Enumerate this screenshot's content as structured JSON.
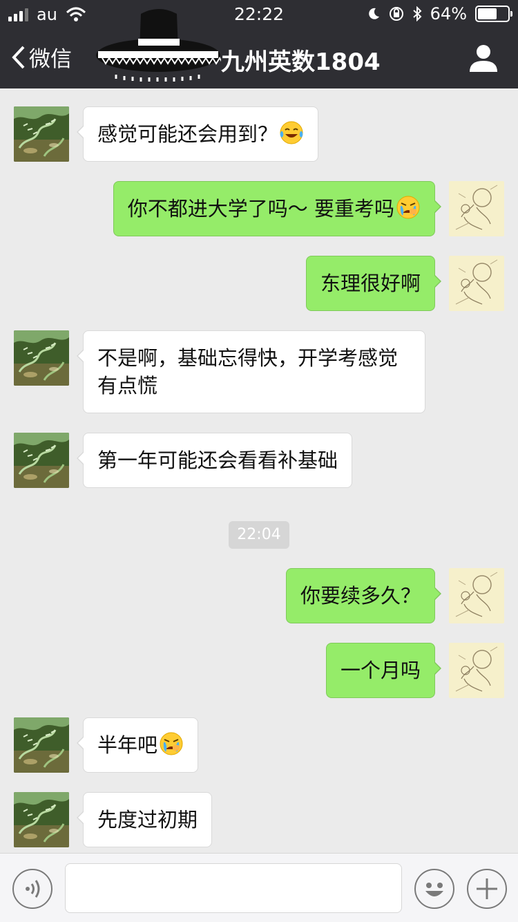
{
  "status_bar": {
    "carrier": "au",
    "time": "22:22",
    "battery_percent": "64%",
    "battery_level": 0.64
  },
  "nav": {
    "back_label": "微信",
    "title": "九州英数1804"
  },
  "messages": [
    {
      "side": "in",
      "text": "感觉可能还会用到？",
      "emoji": "tears-of-joy"
    },
    {
      "side": "out",
      "text": "你不都进大学了吗～ 要重考吗",
      "emoji": "crying"
    },
    {
      "side": "out",
      "text": "东理很好啊"
    },
    {
      "side": "in",
      "text_line1": "不是啊，基础忘得快，开学考感觉",
      "text_line2": "有点慌"
    },
    {
      "side": "in",
      "text": "第一年可能还会看看补基础"
    },
    {
      "side": "out",
      "text": "你要续多久？"
    },
    {
      "side": "out",
      "text": "一个月吗"
    },
    {
      "side": "in",
      "text": "半年吧",
      "emoji": "crying"
    },
    {
      "side": "in",
      "text": "先度过初期"
    }
  ],
  "timestamp": "22:04",
  "input": {
    "value": ""
  },
  "colors": {
    "nav_bg": "#2e2e33",
    "chat_bg": "#ebebeb",
    "outgoing_bubble": "#95ec69",
    "incoming_bubble": "#ffffff"
  },
  "icons": {
    "back": "chevron-left-icon",
    "profile": "person-icon",
    "voice": "voice-icon",
    "emoji": "smiley-icon",
    "more": "plus-icon"
  }
}
